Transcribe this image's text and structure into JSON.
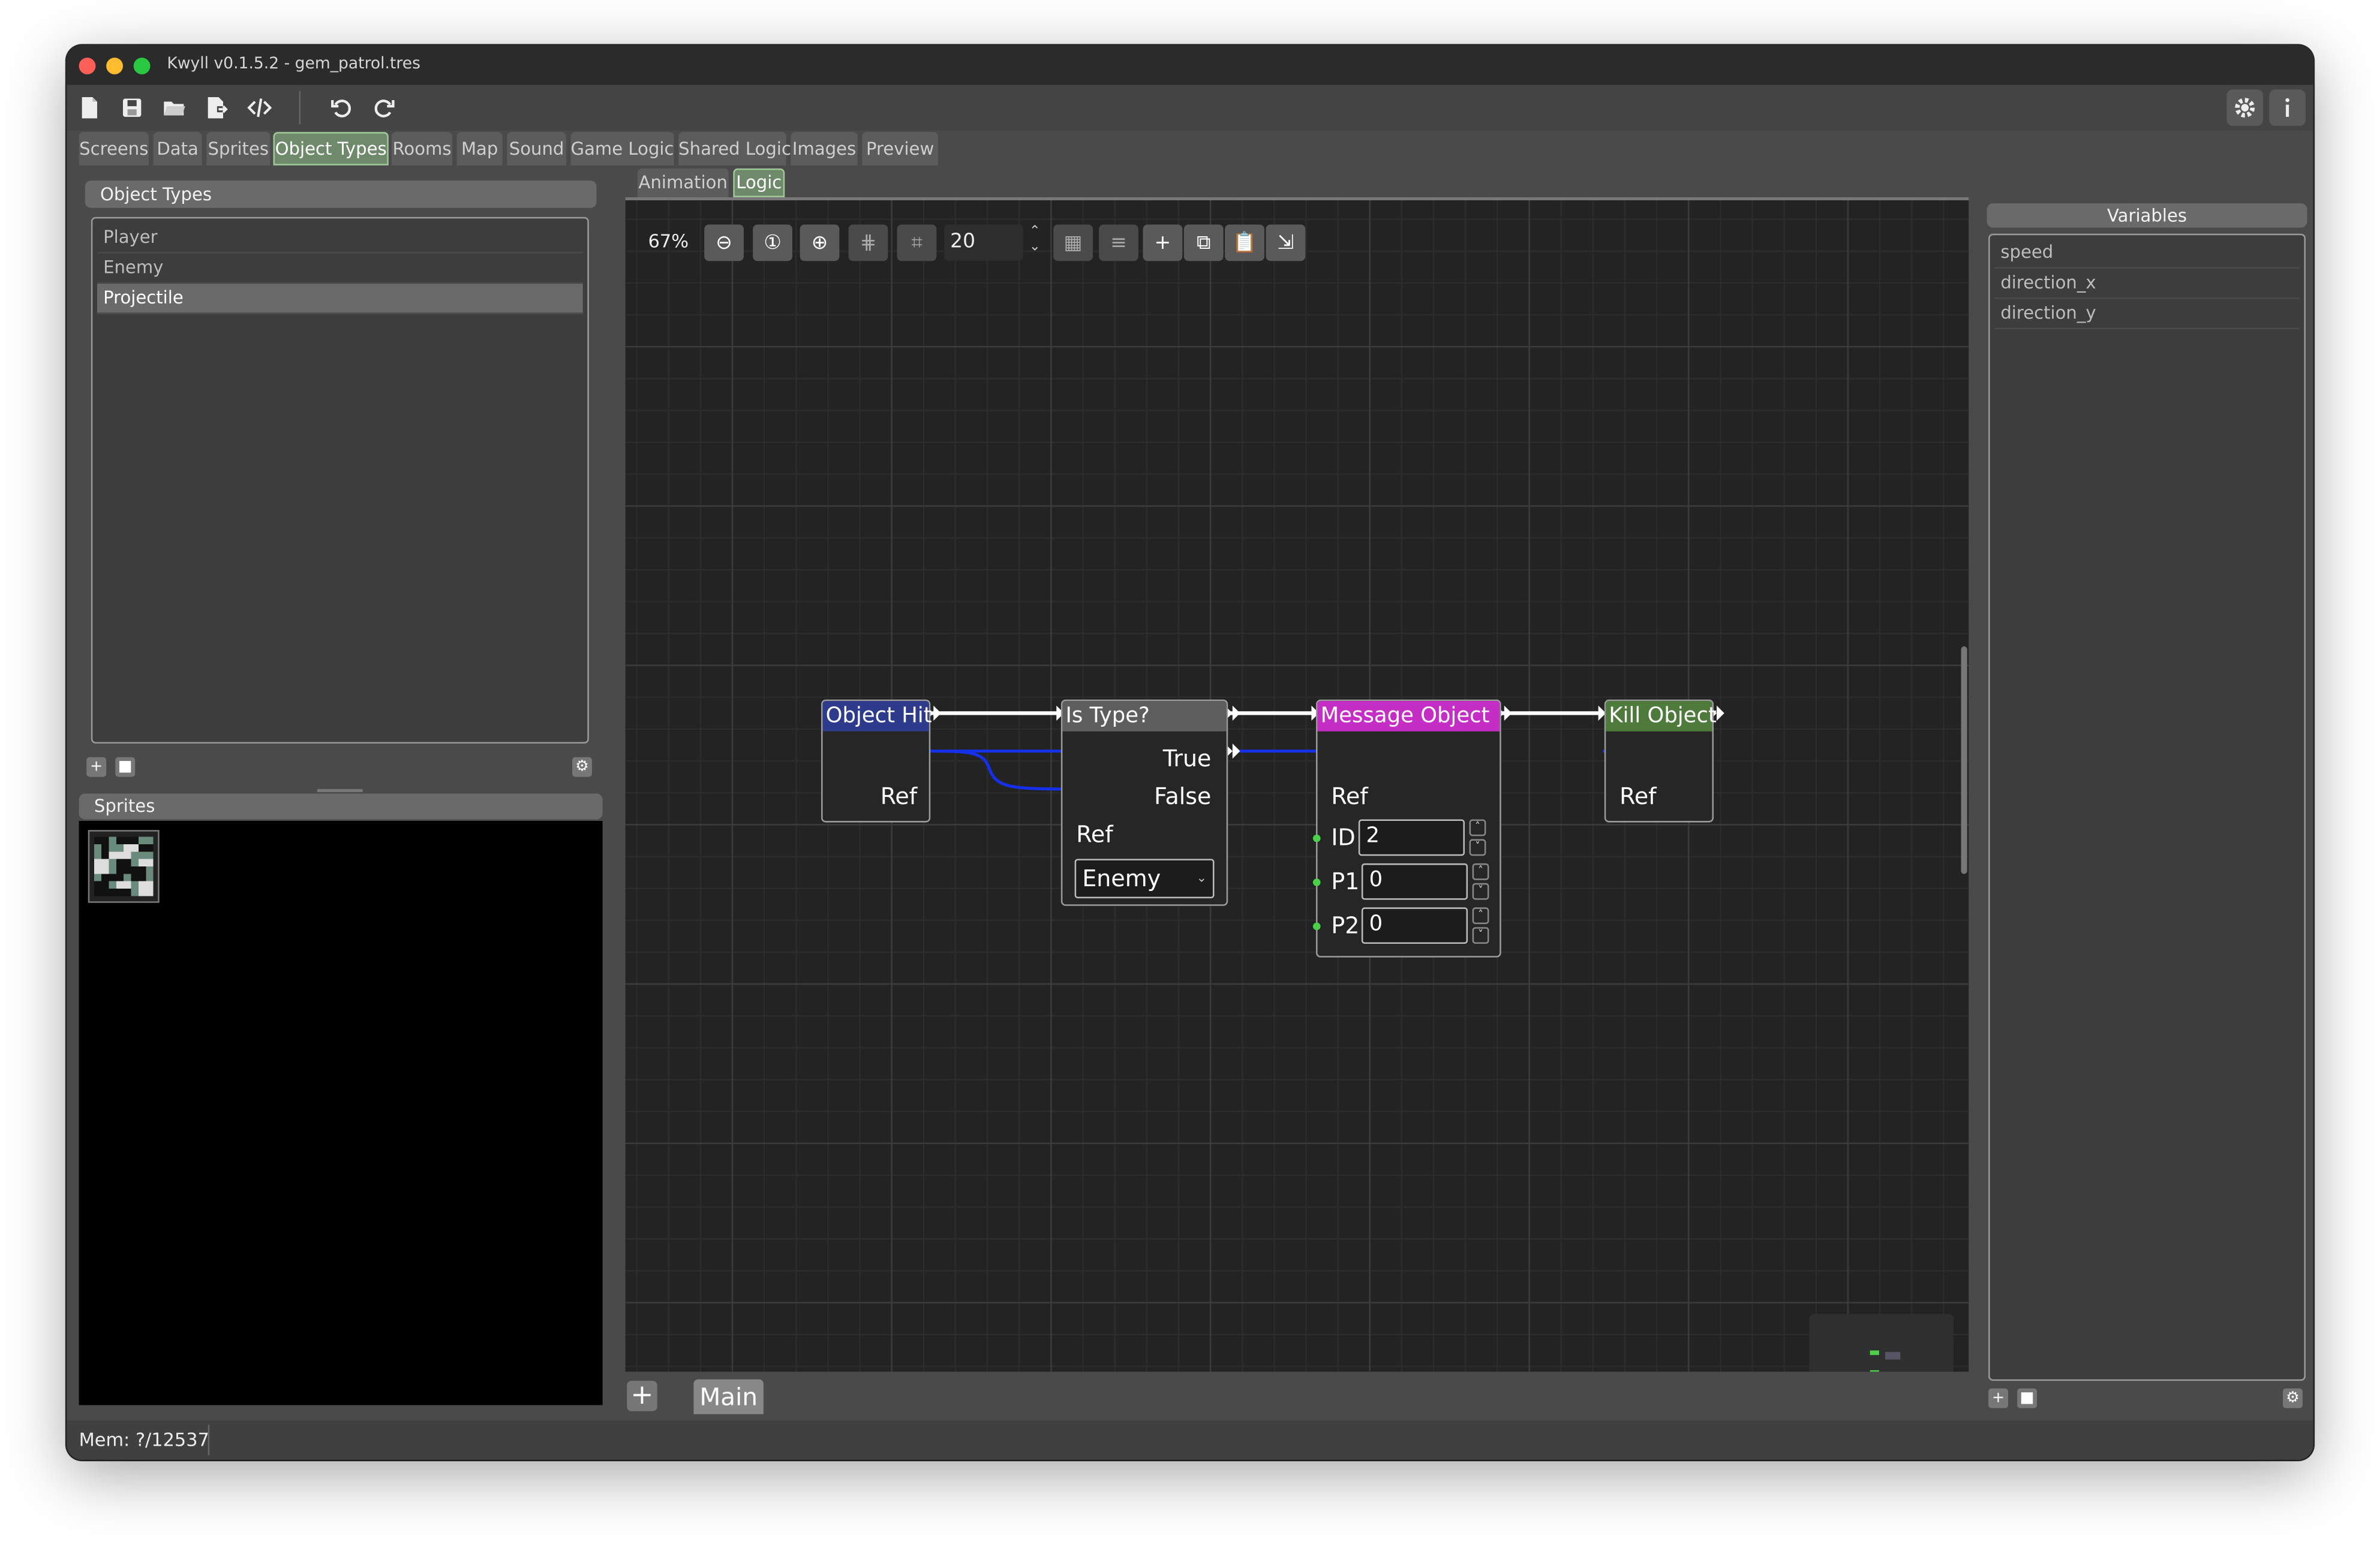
{
  "window": {
    "title": "Kwyll v0.1.5.2 - gem_patrol.tres",
    "traffic_colors": [
      "#fe5f57",
      "#febc2e",
      "#28c840"
    ]
  },
  "toolbar": {
    "icons": [
      "new-file-icon",
      "save-icon",
      "open-folder-icon",
      "export-icon",
      "code-icon",
      "undo-icon",
      "redo-icon",
      "settings-icon",
      "info-icon"
    ]
  },
  "main_tabs": [
    {
      "label": "Screens",
      "active": false
    },
    {
      "label": "Data",
      "active": false
    },
    {
      "label": "Sprites",
      "active": false
    },
    {
      "label": "Object Types",
      "active": true
    },
    {
      "label": "Rooms",
      "active": false
    },
    {
      "label": "Map",
      "active": false
    },
    {
      "label": "Sound",
      "active": false
    },
    {
      "label": "Game Logic",
      "active": false
    },
    {
      "label": "Shared Logic",
      "active": false
    },
    {
      "label": "Images",
      "active": false
    },
    {
      "label": "Preview",
      "active": false
    }
  ],
  "object_types": {
    "header": "Object Types",
    "items": [
      {
        "label": "Player",
        "selected": false
      },
      {
        "label": "Enemy",
        "selected": false
      },
      {
        "label": "Projectile",
        "selected": true
      }
    ]
  },
  "sprites": {
    "header": "Sprites"
  },
  "sub_tabs": [
    {
      "label": "Animation",
      "active": false
    },
    {
      "label": "Logic",
      "active": true
    }
  ],
  "graph_toolbar": {
    "zoom": "67%",
    "snap_value": "20"
  },
  "nodes": {
    "object_hit": {
      "title": "Object Hit",
      "color": "#2e3a8c",
      "ref": "Ref"
    },
    "is_type": {
      "title": "Is Type?",
      "color": "#5e5e5e",
      "true_label": "True",
      "false_label": "False",
      "ref": "Ref",
      "type_value": "Enemy"
    },
    "message_object": {
      "title": "Message Object",
      "color": "#c42ec4",
      "ref": "Ref",
      "id_label": "ID",
      "id_value": "2",
      "p1_label": "P1",
      "p1_value": "0",
      "p2_label": "P2",
      "p2_value": "0"
    },
    "kill_object": {
      "title": "Kill Object",
      "color": "#4e7a3c",
      "ref": "Ref"
    }
  },
  "graph_footer": {
    "add_label": "+",
    "main_tab": "Main"
  },
  "variables": {
    "header": "Variables",
    "items": [
      "speed",
      "direction_x",
      "direction_y"
    ]
  },
  "status": {
    "memory": "Mem: ?/12537"
  }
}
